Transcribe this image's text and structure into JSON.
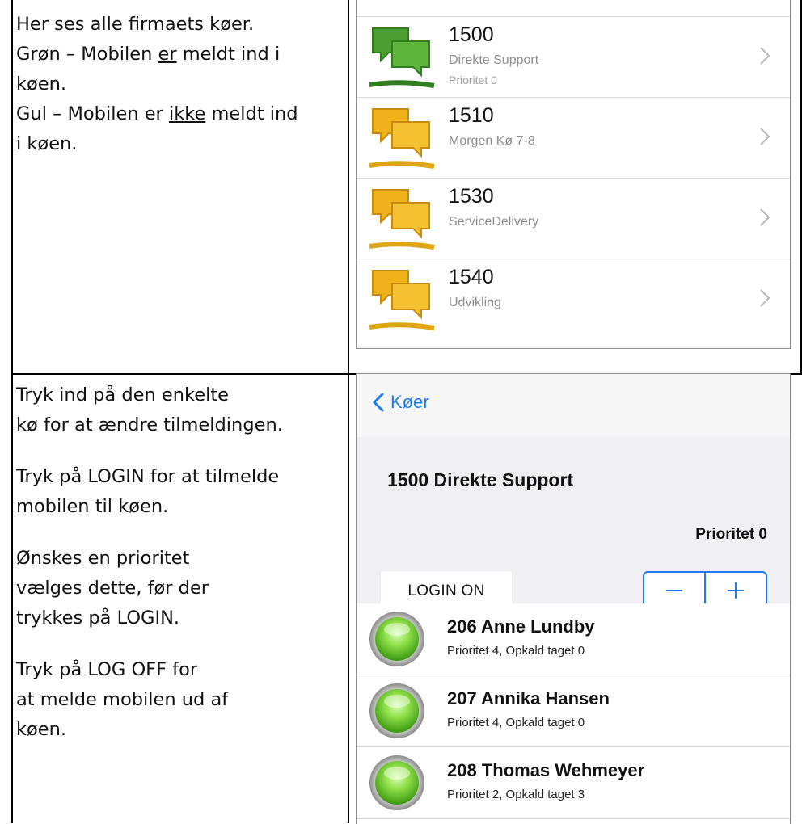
{
  "intro": {
    "line1": "Her ses alle firmaets køer.",
    "green_prefix": "Grøn – Mobilen ",
    "green_underlined": "er",
    "green_suffix": " meldt ind i",
    "green_line2": "køen.",
    "yellow_prefix": "Gul – Mobilen er ",
    "yellow_underlined": "ikke",
    "yellow_suffix": " meldt ind",
    "yellow_line2": "i køen."
  },
  "instructions": {
    "p1_line1": "Tryk ind på den enkelte",
    "p1_line2": "kø for at ændre tilmeldingen.",
    "p2_line1": "Tryk på LOGIN for at tilmelde",
    "p2_line2": "mobilen til køen.",
    "p3_line1": "Ønskes en prioritet",
    "p3_line2": "vælges dette, før der",
    "p3_line3": "trykkes på LOGIN.",
    "p4_line1": "Tryk på LOG OFF for",
    "p4_line2": "at melde mobilen ud af",
    "p4_line3": "køen."
  },
  "queue_list": {
    "items": [
      {
        "number": "1500",
        "name": "Direkte Support",
        "priority": "Prioritet 0",
        "status": "green",
        "icon": "chat-bubbles-green-icon"
      },
      {
        "number": "1510",
        "name": "Morgen Kø 7-8",
        "priority": "",
        "status": "yellow",
        "icon": "chat-bubbles-yellow-icon"
      },
      {
        "number": "1530",
        "name": "ServiceDelivery",
        "priority": "",
        "status": "yellow",
        "icon": "chat-bubbles-yellow-icon"
      },
      {
        "number": "1540",
        "name": "Udvikling",
        "priority": "",
        "status": "yellow",
        "icon": "chat-bubbles-yellow-icon"
      }
    ]
  },
  "queue_detail": {
    "back_label": "Køer",
    "title": "1500 Direkte Support",
    "priority": "Prioritet 0",
    "login_label": "LOGIN ON",
    "stepper_minus": "minus-icon",
    "stepper_plus": "plus-icon",
    "members": [
      {
        "name": "206 Anne Lundby",
        "detail": "Prioritet 4, Opkald taget 0",
        "status": "green"
      },
      {
        "name": "207 Annika Hansen",
        "detail": "Prioritet 4, Opkald taget 0",
        "status": "green"
      },
      {
        "name": "208 Thomas Wehmeyer",
        "detail": "Prioritet 2, Opkald taget 3",
        "status": "green"
      }
    ]
  },
  "colors": {
    "accent_blue": "#1a7cf0",
    "green": "#3f9b2a",
    "yellow": "#f0b21a"
  }
}
